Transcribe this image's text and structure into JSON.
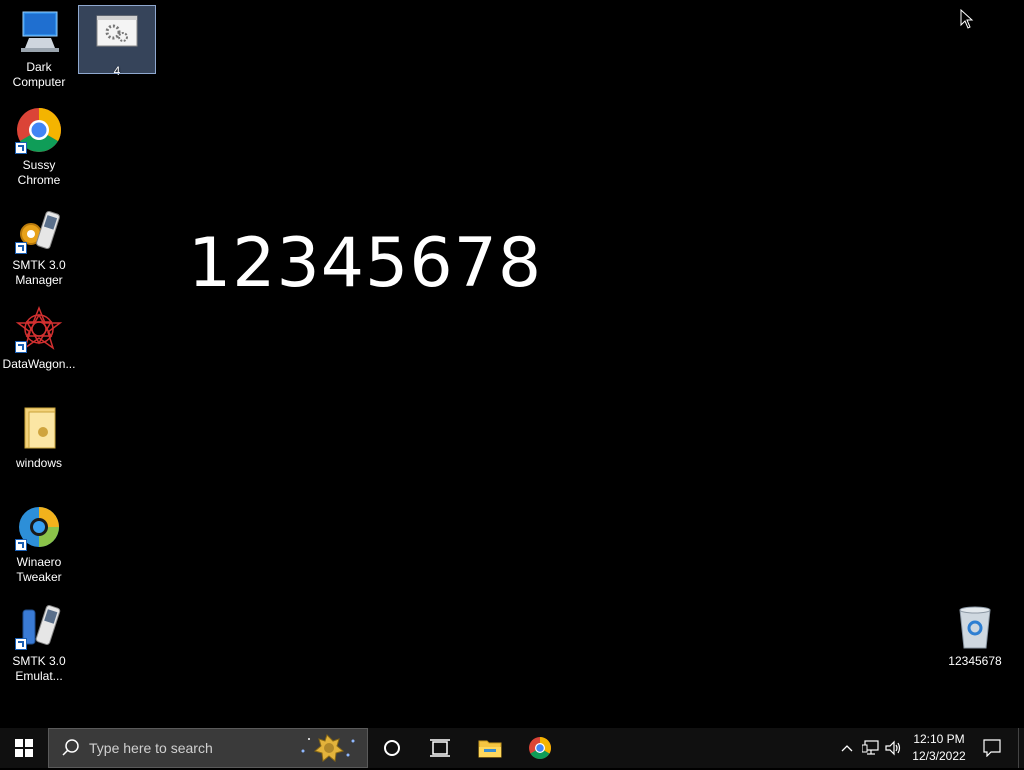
{
  "desktop": {
    "icons": [
      {
        "label": "Dark Computer",
        "icon": "computer-icon"
      },
      {
        "label": "4",
        "icon": "gear-window-icon",
        "selected": true
      },
      {
        "label": "Sussy Chrome",
        "icon": "chrome-icon"
      },
      {
        "label": "SMTK 3.0 Manager",
        "icon": "smtk-manager-icon"
      },
      {
        "label": "DataWagon...",
        "icon": "datawagon-icon"
      },
      {
        "label": "windows",
        "icon": "folder-icon"
      },
      {
        "label": "Winaero Tweaker",
        "icon": "winaero-icon"
      },
      {
        "label": "SMTK 3.0 Emulat...",
        "icon": "smtk-emulator-icon"
      },
      {
        "label": "12345678",
        "icon": "recycle-bin-icon"
      }
    ],
    "wallpaper_text": "12345678"
  },
  "taskbar": {
    "search_placeholder": "Type here to search",
    "time": "12:10 PM",
    "date": "12/3/2022"
  },
  "colors": {
    "taskbar": "#101010",
    "search_box": "#3a3a3a",
    "desktop": "#000000"
  }
}
